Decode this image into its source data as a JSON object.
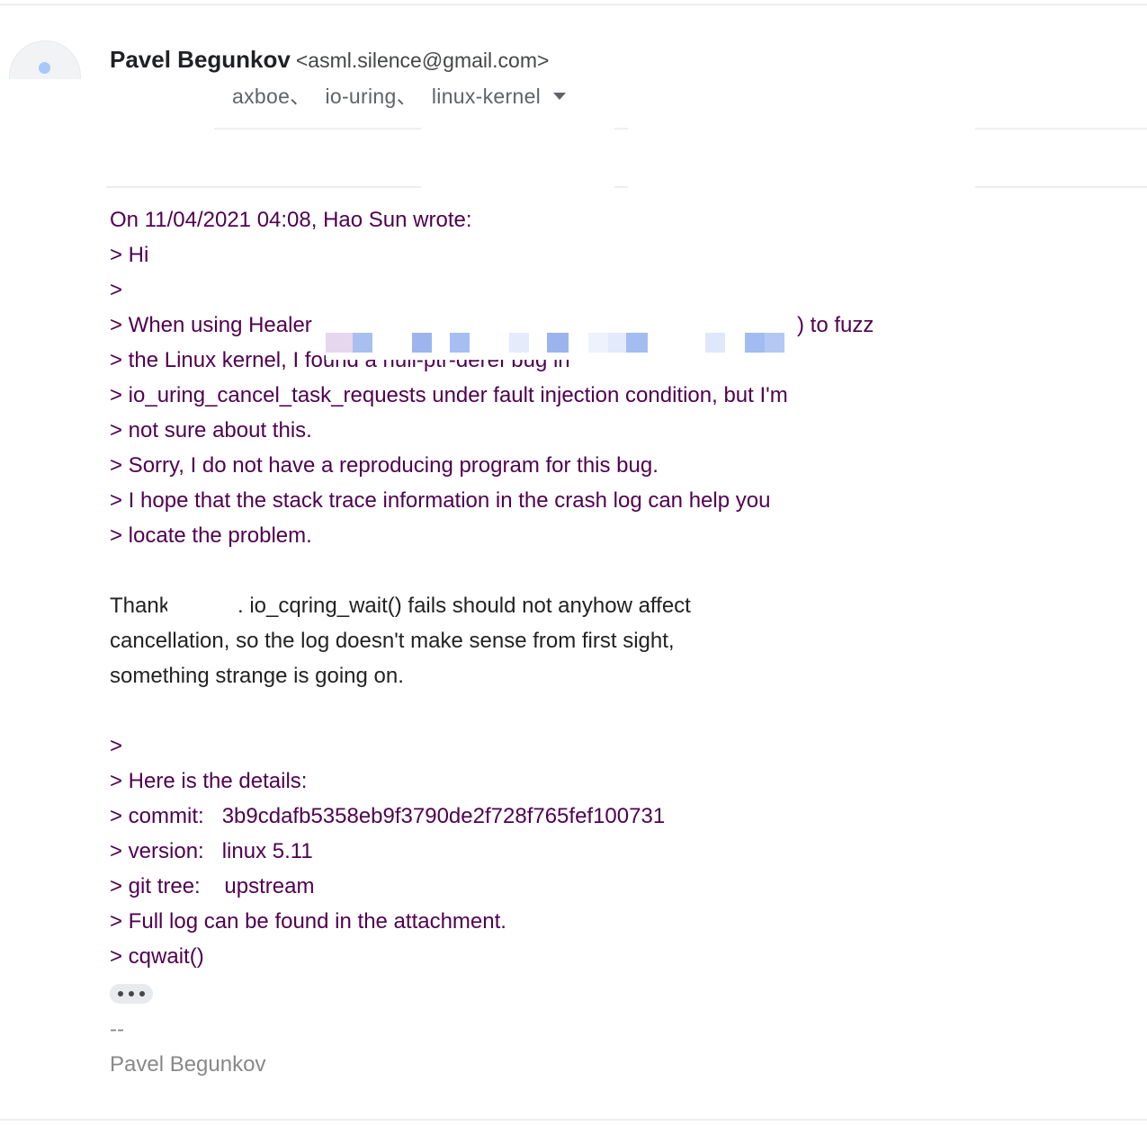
{
  "message": {
    "sender": {
      "name": "Pavel Begunkov",
      "email": "<asml.silence@gmail.com>"
    },
    "recipients": [
      "axboe、",
      "io-uring、",
      "linux-kernel"
    ],
    "body": {
      "quote_header": "On 11/04/2021 04:08, Hao Sun wrote:",
      "quoted_1": [
        "> Hi",
        ">",
        "> When using Healer",
        "> the Linux kernel, I found a null-ptr-deref bug in",
        "> io_uring_cancel_task_requests under fault injection condition, but I'm",
        "> not sure about this.",
        "> Sorry, I do not have a reproducing program for this bug.",
        "> I hope that the stack trace information in the crash log can help you",
        "> locate the problem."
      ],
      "quoted_1_tail": ") to fuzz",
      "reply": [
        "Thank",
        ". io_cqring_wait() fails should not anyhow affect",
        "cancellation, so the log doesn't make sense from first sight,",
        "something strange is going on."
      ],
      "quoted_2": [
        ">",
        "> Here is the details:",
        "> commit:   3b9cdafb5358eb9f3790de2f728f765fef100731",
        "> version:   linux 5.11",
        "> git tree:    upstream",
        "> Full log can be found in the attachment.",
        "> cqwait()"
      ]
    },
    "signature": {
      "separator": "--",
      "name": "Pavel Begunkov"
    }
  },
  "colors": {
    "quote_text": "#500050",
    "body_text": "#222222",
    "signature_text": "#888888",
    "divider": "#eeeeee",
    "avatar_dot": "#a8c7fa"
  }
}
